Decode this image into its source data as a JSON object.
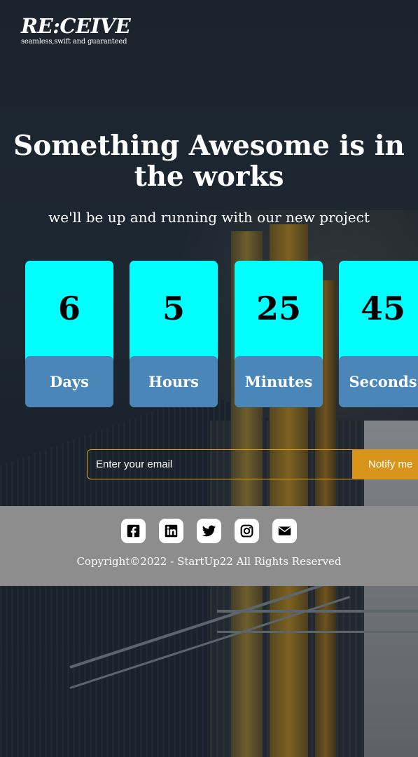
{
  "brand": {
    "name": "RE:CEIVE",
    "tagline": "seamless,swift and guaranteed"
  },
  "hero": {
    "title": "Something Awesome is in the works",
    "subtitle": "we'll be up and running with our new project"
  },
  "countdown": [
    {
      "value": "6",
      "label": "Days"
    },
    {
      "value": "5",
      "label": "Hours"
    },
    {
      "value": "25",
      "label": "Minutes"
    },
    {
      "value": "45",
      "label": "Seconds"
    }
  ],
  "signup": {
    "placeholder": "Enter your email",
    "button_label": "Notify me"
  },
  "footer": {
    "socials": [
      "facebook-icon",
      "linkedin-icon",
      "twitter-icon",
      "instagram-icon",
      "mail-icon"
    ],
    "copyright": "Copyright©2022 - StartUp22 All Rights Reserved"
  },
  "colors": {
    "countdown_number_bg": "#00ffff",
    "countdown_label_bg": "#4a86b8",
    "accent": "#d9951b",
    "footer_bg": "#8d8d8d"
  }
}
